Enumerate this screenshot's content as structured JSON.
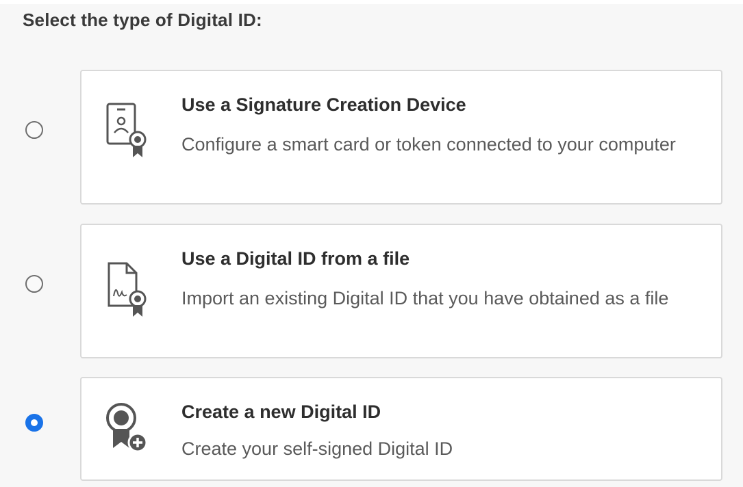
{
  "heading": "Select the type of Digital ID:",
  "accent_color": "#1a73e8",
  "options": [
    {
      "title": "Use a Signature Creation Device",
      "description": "Configure a smart card or token connected to your computer",
      "icon": "signature-device-icon",
      "selected": false
    },
    {
      "title": "Use a Digital ID from a file",
      "description": "Import an existing Digital ID that you have obtained as a file",
      "icon": "digital-id-file-icon",
      "selected": false
    },
    {
      "title": "Create a new Digital ID",
      "description": "Create your self-signed Digital ID",
      "icon": "new-digital-id-icon",
      "selected": true
    }
  ]
}
